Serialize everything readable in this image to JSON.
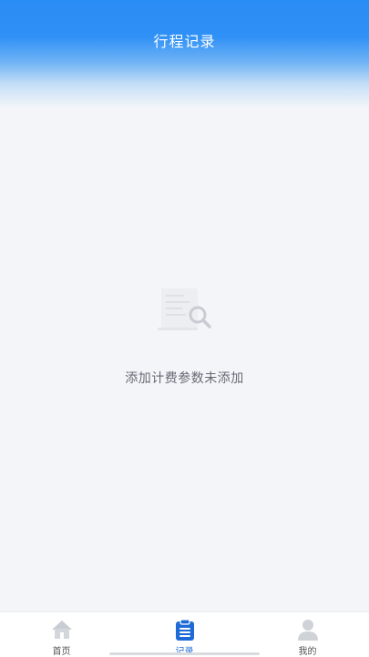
{
  "header": {
    "title": "行程记录"
  },
  "empty_state": {
    "icon": "document-search-icon",
    "message": "添加计费参数未添加"
  },
  "tabbar": {
    "tabs": [
      {
        "label": "首页",
        "icon": "home-icon",
        "active": false
      },
      {
        "label": "记录",
        "icon": "clipboard-icon",
        "active": true
      },
      {
        "label": "我的",
        "icon": "user-icon",
        "active": false
      }
    ]
  },
  "colors": {
    "accent": "#1e6ad6",
    "header": "#2a8cf5",
    "background": "#f3f5f9"
  }
}
